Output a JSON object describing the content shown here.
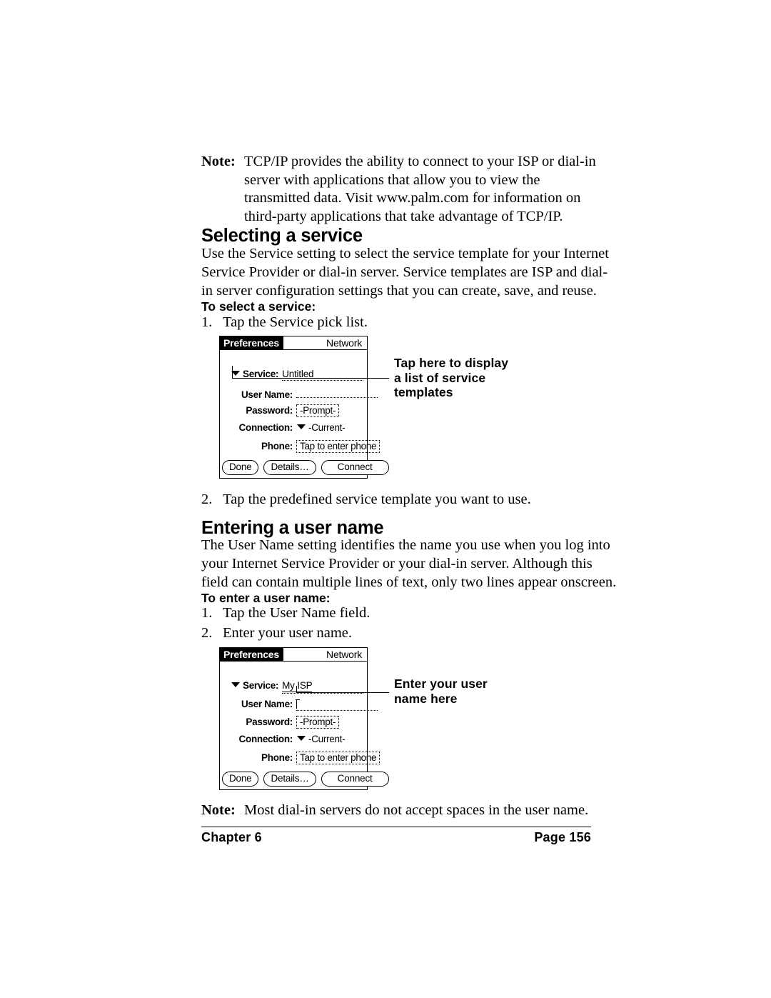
{
  "top_note": {
    "label": "Note:",
    "lines": [
      "TCP/IP provides the ability to connect to your ISP or dial-in",
      "server with applications that allow you to view the",
      "transmitted data. Visit www.palm.com for information on",
      "third-party applications that take advantage of TCP/IP."
    ]
  },
  "section1": {
    "heading": "Selecting a service",
    "paragraph": [
      "Use the Service setting to select the service template for your Internet",
      "Service Provider or dial-in server. Service templates are ISP and dial-",
      "in server configuration settings that you can create, save, and reuse."
    ],
    "subhead": "To select a service:",
    "step1_num": "1.",
    "step1_text": "Tap the Service pick list.",
    "step2_num": "2.",
    "step2_text": "Tap the predefined service template you want to use."
  },
  "screenshot1": {
    "title_left": "Preferences",
    "title_right": "Network",
    "fields": {
      "service_label": "Service:",
      "service_value": "Untitled",
      "username_label": "User Name:",
      "username_value": "",
      "password_label": "Password:",
      "password_value": "-Prompt-",
      "connection_label": "Connection:",
      "connection_value": "-Current-",
      "phone_label": "Phone:",
      "phone_value": "Tap to enter phone"
    },
    "buttons": {
      "done": "Done",
      "details": "Details…",
      "connect": "Connect"
    },
    "callout": [
      "Tap here to display",
      "a list of service",
      "templates"
    ]
  },
  "section2": {
    "heading": "Entering a user name",
    "paragraph": [
      "The User Name setting identifies the name you use when you log into",
      "your Internet Service Provider or your dial-in server. Although this",
      "field can contain multiple lines of text, only two lines appear onscreen."
    ],
    "subhead": "To enter a user name:",
    "step1_num": "1.",
    "step1_text": "Tap the User Name field.",
    "step2_num": "2.",
    "step2_text": "Enter your user name."
  },
  "screenshot2": {
    "title_left": "Preferences",
    "title_right": "Network",
    "fields": {
      "service_label": "Service:",
      "service_value": "My ISP",
      "username_label": "User Name:",
      "username_value": "",
      "password_label": "Password:",
      "password_value": "-Prompt-",
      "connection_label": "Connection:",
      "connection_value": "-Current-",
      "phone_label": "Phone:",
      "phone_value": "Tap to enter phone"
    },
    "buttons": {
      "done": "Done",
      "details": "Details…",
      "connect": "Connect"
    },
    "callout": [
      "Enter your user",
      "name here"
    ]
  },
  "bottom_note": {
    "label": "Note:",
    "lines": [
      "Most dial-in servers do not accept spaces in the user name."
    ]
  },
  "footer": {
    "left": "Chapter 6",
    "right": "Page 156"
  }
}
